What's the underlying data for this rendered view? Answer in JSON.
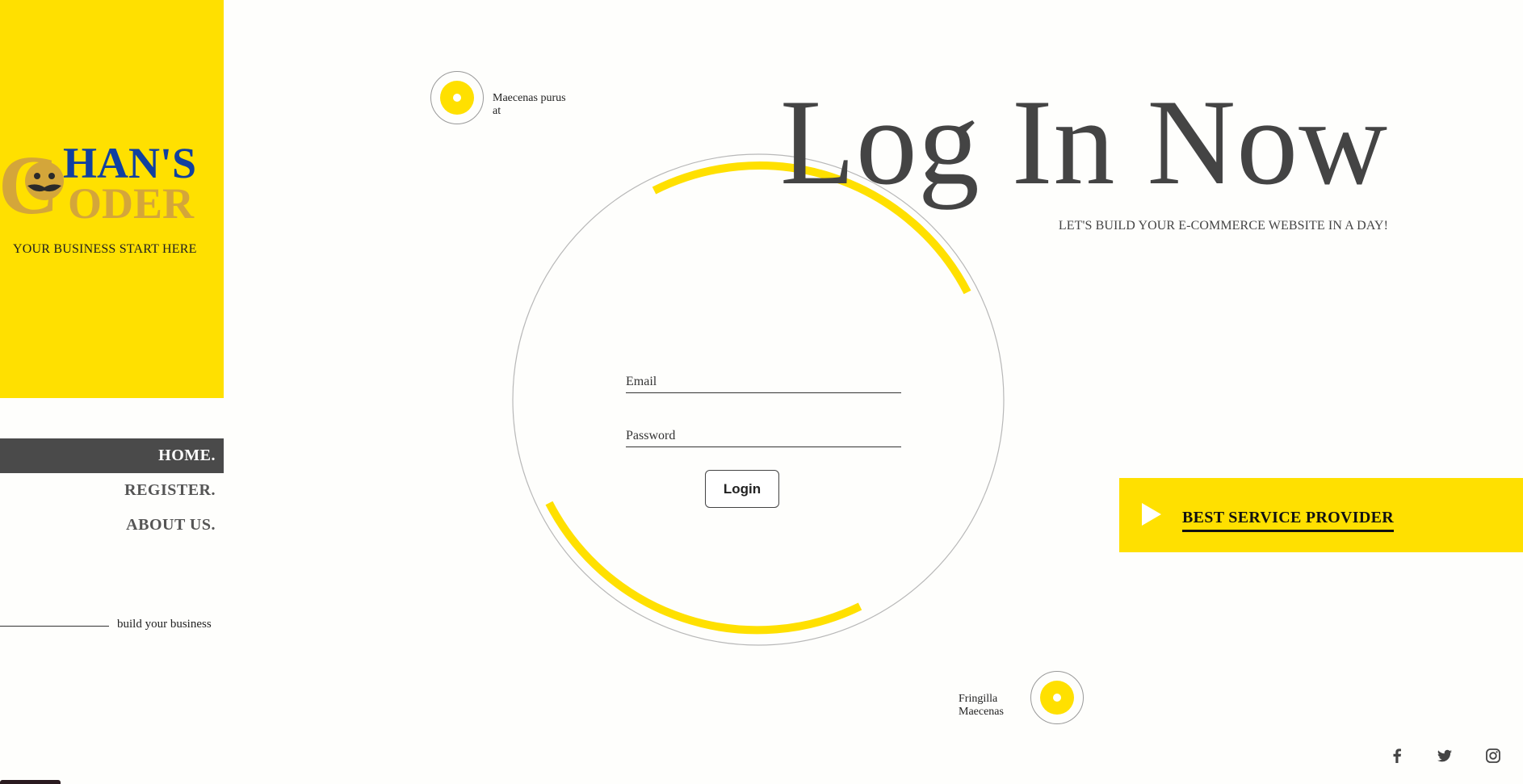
{
  "sidebar": {
    "logo_text_top": "HAN'S",
    "logo_text_bottom": "ODER",
    "logo_letter": "C",
    "tagline": "YOUR BUSINESS START HERE",
    "nav": [
      {
        "label": "HOME.",
        "active": true
      },
      {
        "label": "REGISTER.",
        "active": false
      },
      {
        "label": "ABOUT US.",
        "active": false
      }
    ],
    "footer_text": "build your business"
  },
  "badges": {
    "top": {
      "text_line1": "Maecenas purus",
      "text_line2": "at"
    },
    "bottom": {
      "text_line1": "Fringilla",
      "text_line2": "Maecenas"
    }
  },
  "form": {
    "email_placeholder": "Email",
    "password_placeholder": "Password",
    "login_label": "Login"
  },
  "hero": {
    "title": "Log In Now",
    "subtitle": "LET'S BUILD YOUR E-COMMERCE WEBSITE IN A DAY!"
  },
  "cta": {
    "label": "BEST SERVICE PROVIDER"
  },
  "social": [
    "facebook-icon",
    "twitter-icon",
    "instagram-icon"
  ],
  "colors": {
    "accent": "#ffe000",
    "dark": "#4a4a4a",
    "logo_gold": "#d4a63a",
    "logo_blue": "#1040a0"
  }
}
